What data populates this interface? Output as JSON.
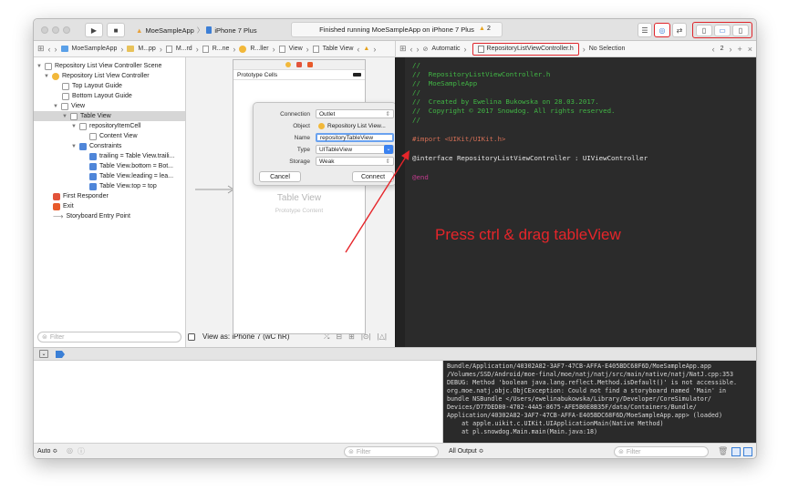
{
  "window": {
    "scheme_app": "MoeSampleApp",
    "scheme_device": "iPhone 7 Plus",
    "status": "Finished running MoeSampleApp on iPhone 7 Plus",
    "warnings": "2"
  },
  "jumpbar_left": {
    "items": [
      "MoeSampleApp",
      "M...pp",
      "M...rd",
      "R...ne",
      "R...ller",
      "View",
      "Table View"
    ]
  },
  "jumpbar_right": {
    "mode": "Automatic",
    "file": "RepositoryListViewController.h",
    "selection": "No Selection",
    "counter": "2"
  },
  "outline": {
    "items": [
      "Repository List View Controller Scene",
      "Repository List View Controller",
      "Top Layout Guide",
      "Bottom Layout Guide",
      "View",
      "Table View",
      "repositoryItemCell",
      "Content View",
      "Constraints",
      "trailing = Table View.traili...",
      "Table View.bottom = Bot...",
      "Table View.leading = lea...",
      "Table View.top = top",
      "First Responder",
      "Exit",
      "Storyboard Entry Point"
    ],
    "filter_placeholder": "Filter"
  },
  "canvas": {
    "prototype_cells": "Prototype Cells",
    "table_view": "Table View",
    "prototype_content": "Prototype Content",
    "view_as": "View as: iPhone 7 (wC hR)"
  },
  "popover": {
    "connection_label": "Connection",
    "connection_value": "Outlet",
    "object_label": "Object",
    "object_value": "Repository List View...",
    "name_label": "Name",
    "name_value": "repositoryTableView",
    "type_label": "Type",
    "type_value": "UITableView",
    "storage_label": "Storage",
    "storage_value": "Weak",
    "cancel": "Cancel",
    "connect": "Connect"
  },
  "code": {
    "lines": [
      "//",
      "//  RepositoryListViewController.h",
      "//  MoeSampleApp",
      "//",
      "//  Created by Ewelina Bukowska on 28.03.2017.",
      "//  Copyright © 2017 Snowdog. All rights reserved.",
      "//",
      "",
      "#import <UIKit/UIKit.h>",
      "",
      "@interface RepositoryListViewController : UIViewController",
      "",
      "@end"
    ]
  },
  "annotation": "Press ctrl & drag tableView",
  "console": {
    "lines": [
      "Bundle/Application/40302A82-3AF7-47CB-AFFA-E405BDC68F6D/MoeSampleApp.app",
      "/Volumes/SSD/Android/moe-final/moe/natj/natj/src/main/native/natj/NatJ.cpp:353",
      "DEBUG: Method 'boolean java.lang.reflect.Method.isDefault()' is not accessible.",
      "org.moe.natj.objc.ObjCException: Could not find a storyboard named 'Main' in",
      "bundle NSBundle </Users/ewelinabukowska/Library/Developer/CoreSimulator/",
      "Devices/D77DED80-4702-44A5-8675-AFE5B0E8B35F/data/Containers/Bundle/",
      "Application/40302A82-3AF7-47CB-AFFA-E405BDC68F6D/MoeSampleApp.app> (loaded)",
      "    at apple.uikit.c.UIKit.UIApplicationMain(Native Method)",
      "    at pl.snowdog.Main.main(Main.java:18)"
    ]
  },
  "bottombar": {
    "auto": "Auto ≎",
    "all_output": "All Output ≎",
    "filter": "Filter"
  },
  "colors": {
    "accent_red": "#e6252a",
    "code_comment": "#41b645",
    "code_keyword": "#c23b8e",
    "code_class": "#4fb3d6",
    "code_import": "#d26e55"
  }
}
